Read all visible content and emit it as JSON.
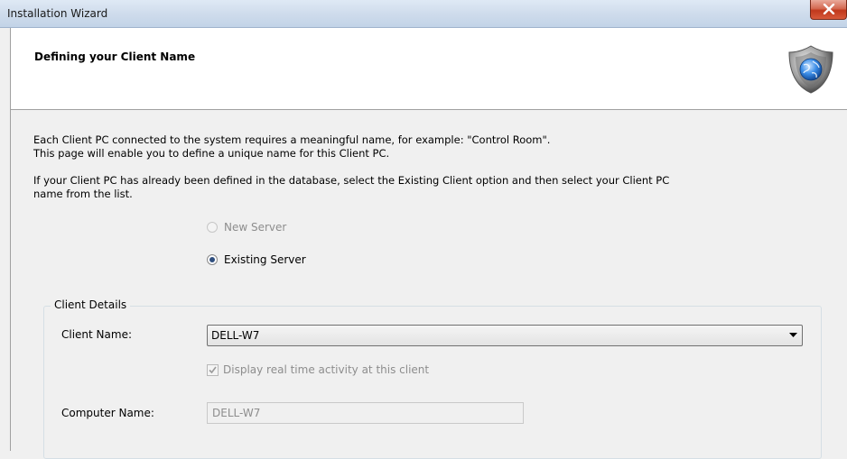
{
  "window": {
    "title": "Installation Wizard",
    "close_icon": "close-icon"
  },
  "header": {
    "title": "Defining your Client Name",
    "icon": "shield-globe-icon"
  },
  "body": {
    "para1_line1": "Each Client PC connected to the system requires a meaningful name, for example: \"Control Room\".",
    "para1_line2": "This page will enable you to define a unique name for this Client PC.",
    "para2_line1": "If your Client PC has already been defined in the database, select the Existing Client option and then select your Client PC",
    "para2_line2": "name from the list.",
    "radio_new": {
      "label": "New Server",
      "checked": false,
      "enabled": false
    },
    "radio_existing": {
      "label": "Existing Server",
      "checked": true,
      "enabled": true
    }
  },
  "client_details": {
    "group_label": "Client Details",
    "client_name_label": "Client Name:",
    "client_name_value": "DELL-W7",
    "realtime_checkbox_label": "Display real time activity at this client",
    "realtime_checked": true,
    "computer_name_label": "Computer Name:",
    "computer_name_value": "DELL-W7"
  },
  "colors": {
    "close_button": "#c0381c",
    "radio_dot": "#2f4e7e",
    "disabled_text": "#8d8d8d"
  }
}
